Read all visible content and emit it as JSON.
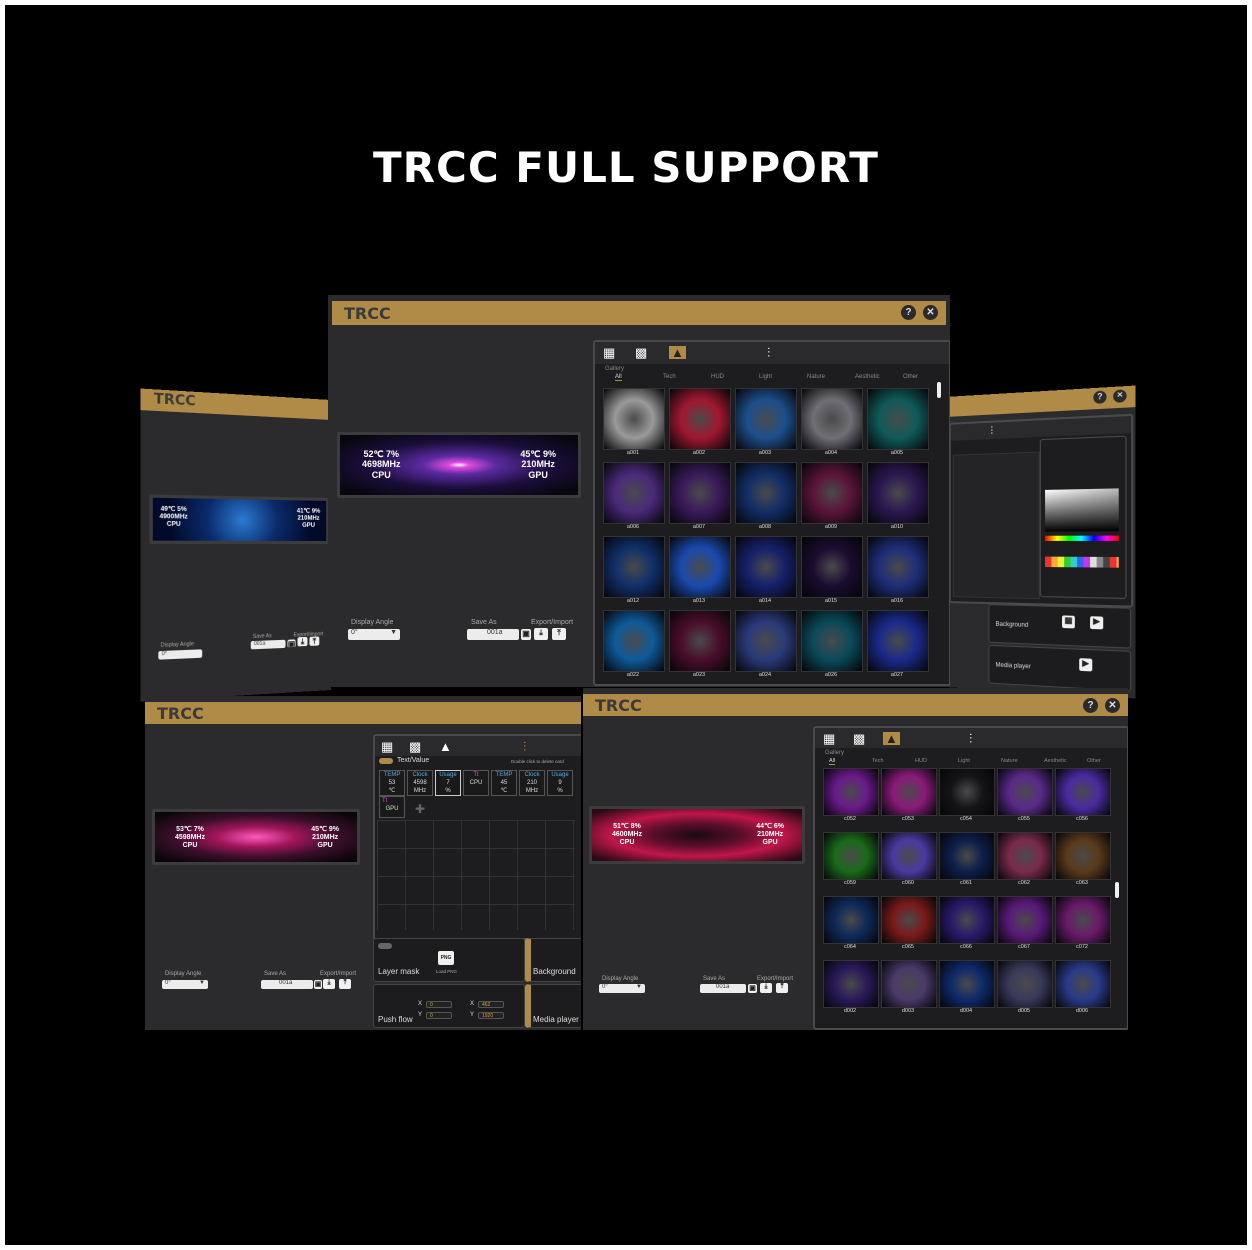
{
  "headline": "TRCC FULL SUPPORT",
  "app_title": "TRCC",
  "help_glyph": "?",
  "close_glyph": "✕",
  "labels": {
    "display_angle": "Display Angle",
    "save_as": "Save As",
    "export_import": "Export/Import",
    "angle_value": "0°",
    "save_value": "001a",
    "gallery": "Gallery",
    "text_value": "Text/Value",
    "double_click_delete": "Double click to delete card",
    "layer_mask": "Layer mask",
    "load_png": "Load PNG",
    "background": "Background",
    "push_flow": "Push flow",
    "media_player": "Media player",
    "x": "X",
    "y": "Y",
    "png": "PNG",
    "gpu": "GPU",
    "cpu": "CPU"
  },
  "categories": [
    "All",
    "Tech",
    "HUD",
    "Light",
    "Nature",
    "Aesthetic",
    "Other"
  ],
  "lcd_stats": {
    "main": {
      "cpu_temp": "52℃ 7%",
      "cpu_clock": "4698MHz",
      "cpu": "CPU",
      "gpu_temp": "45℃ 9%",
      "gpu_clock": "210MHz",
      "gpu": "GPU"
    },
    "left": {
      "cpu_temp": "49℃ 5%",
      "cpu_clock": "4900MHz",
      "cpu": "CPU",
      "gpu_temp": "41℃ 9%",
      "gpu_clock": "210MHz",
      "gpu": "GPU"
    },
    "bl": {
      "cpu_temp": "53℃ 7%",
      "cpu_clock": "4598MHz",
      "cpu": "CPU",
      "gpu_temp": "45℃ 9%",
      "gpu_clock": "210MHz",
      "gpu": "GPU"
    },
    "br": {
      "cpu_temp": "51℃ 8%",
      "cpu_clock": "4600MHz",
      "cpu": "CPU",
      "gpu_temp": "44℃ 6%",
      "gpu_clock": "210MHz",
      "gpu": "GPU"
    }
  },
  "gallery_main": [
    {
      "id": "a001",
      "color": "#9a9a9a"
    },
    {
      "id": "a002",
      "color": "#a01830"
    },
    {
      "id": "a003",
      "color": "#1d4f8c"
    },
    {
      "id": "a004",
      "color": "#6f6f74"
    },
    {
      "id": "a005",
      "color": "#0f5b5a"
    },
    {
      "id": "a006",
      "color": "#4a2a7a"
    },
    {
      "id": "a007",
      "color": "#3a1a5a"
    },
    {
      "id": "a008",
      "color": "#122e66"
    },
    {
      "id": "a009",
      "color": "#5a1438"
    },
    {
      "id": "a010",
      "color": "#2a1850"
    },
    {
      "id": "a012",
      "color": "#10306a"
    },
    {
      "id": "a013",
      "color": "#1a4ab0"
    },
    {
      "id": "a014",
      "color": "#16206a"
    },
    {
      "id": "a015",
      "color": "#1a0c30"
    },
    {
      "id": "a016",
      "color": "#1e2e78"
    },
    {
      "id": "a022",
      "color": "#0e5a9a"
    },
    {
      "id": "a023",
      "color": "#4a0e2a"
    },
    {
      "id": "a024",
      "color": "#2a3a7a"
    },
    {
      "id": "a026",
      "color": "#0a4a5a"
    },
    {
      "id": "a027",
      "color": "#1a2a8a"
    }
  ],
  "gallery_br": [
    {
      "id": "c052",
      "color": "#6a1a8a"
    },
    {
      "id": "c053",
      "color": "#8a1a7a"
    },
    {
      "id": "c054",
      "color": "#151518"
    },
    {
      "id": "c055",
      "color": "#5a2a8a"
    },
    {
      "id": "c056",
      "color": "#4a2aa0"
    },
    {
      "id": "c059",
      "color": "#1a6a1a"
    },
    {
      "id": "c060",
      "color": "#4a3aa0"
    },
    {
      "id": "c061",
      "color": "#0e1e4a"
    },
    {
      "id": "c062",
      "color": "#7a2a4a"
    },
    {
      "id": "c063",
      "color": "#5a3a1a"
    },
    {
      "id": "c064",
      "color": "#0e2a5a"
    },
    {
      "id": "c065",
      "color": "#7a1a1a"
    },
    {
      "id": "c066",
      "color": "#2a1a6a"
    },
    {
      "id": "c067",
      "color": "#5a1a7a"
    },
    {
      "id": "c072",
      "color": "#6a1a6a"
    },
    {
      "id": "d002",
      "color": "#2a1a5a"
    },
    {
      "id": "d003",
      "color": "#4a3a6a"
    },
    {
      "id": "d004",
      "color": "#0e2a6a"
    },
    {
      "id": "d005",
      "color": "#3a3a5a"
    },
    {
      "id": "d006",
      "color": "#2a3a8a"
    }
  ],
  "tv_cards": [
    {
      "head": "TEMP",
      "value": "53",
      "unit": "℃"
    },
    {
      "head": "Clock",
      "value": "4598",
      "unit": "MHz"
    },
    {
      "head": "Usage",
      "value": "7",
      "unit": "%"
    },
    {
      "head": "Tt",
      "value": "CPU",
      "unit": ""
    },
    {
      "head": "TEMP",
      "value": "45",
      "unit": "℃"
    },
    {
      "head": "Clock",
      "value": "210",
      "unit": "MHz"
    },
    {
      "head": "Usage",
      "value": "9",
      "unit": "%"
    }
  ],
  "push_flow": {
    "x1": "0",
    "y1": "0",
    "x2": "462",
    "y2": "1920"
  },
  "colors": {
    "gold": "#b08a47",
    "panel": "#2b2b2d",
    "black": "#000000"
  }
}
